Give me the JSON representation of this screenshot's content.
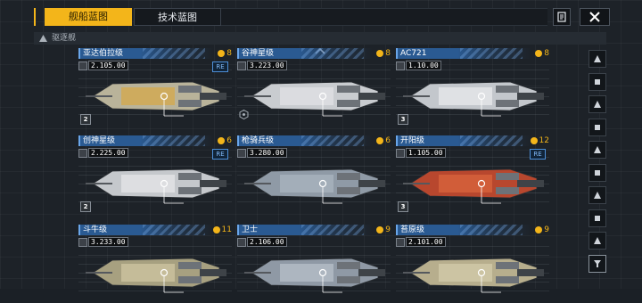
{
  "tabs": [
    {
      "label": "舰船蓝图",
      "active": true
    },
    {
      "label": "技术蓝图",
      "active": false
    }
  ],
  "header_buttons": {
    "manual_icon": "document-icon",
    "close_icon": "close-icon"
  },
  "category": {
    "label": "驱逐舰",
    "icon": "ship-class-icon"
  },
  "colors": {
    "accent": "#f3b51a",
    "name_bar": "#2a5a92",
    "re_badge": "#4d8fd8"
  },
  "cards": [
    {
      "name": "亚达伯拉级",
      "cost": "8",
      "stat": "2.105.00",
      "re": "RE",
      "level": "2",
      "hull": "#b9b39a",
      "accent": "#d6a84a"
    },
    {
      "name": "谷神星级",
      "cost": "8",
      "stat": "3.223.00",
      "re": "",
      "level": "",
      "hull": "#c9ccd0",
      "accent": "#e0e2e5"
    },
    {
      "name": "AC721",
      "cost": "8",
      "stat": "1.10.00",
      "re": "",
      "level": "3",
      "hull": "#c3c7cc",
      "accent": "#e8eaec"
    },
    {
      "name": "创神星级",
      "cost": "6",
      "stat": "2.225.00",
      "re": "RE",
      "level": "2",
      "hull": "#c5c8cc",
      "accent": "#e4e6e8"
    },
    {
      "name": "枪骑兵级",
      "cost": "6",
      "stat": "3.280.00",
      "re": "",
      "level": "",
      "hull": "#8f9aa6",
      "accent": "#aab4bf"
    },
    {
      "name": "开阳级",
      "cost": "12",
      "stat": "1.105.00",
      "re": "RE",
      "level": "3",
      "hull": "#b8472e",
      "accent": "#d9643d"
    },
    {
      "name": "斗牛级",
      "cost": "11",
      "stat": "3.233.00",
      "re": "",
      "level": "",
      "hull": "#a7a080",
      "accent": "#cfc6a1"
    },
    {
      "name": "卫士",
      "cost": "9",
      "stat": "2.106.00",
      "re": "",
      "level": "",
      "hull": "#8f99a5",
      "accent": "#b7c0ca"
    },
    {
      "name": "苔原级",
      "cost": "9",
      "stat": "2.101.00",
      "re": "",
      "level": "",
      "hull": "#b7ae8d",
      "accent": "#d3cbab"
    }
  ],
  "side_nav": [
    "cruiser-icon",
    "carrier-icon",
    "frigate-icon",
    "destroyer-icon",
    "corvette-icon",
    "battleship-icon",
    "support-icon",
    "auxiliary-icon",
    "dock-icon",
    "filter-icon"
  ]
}
